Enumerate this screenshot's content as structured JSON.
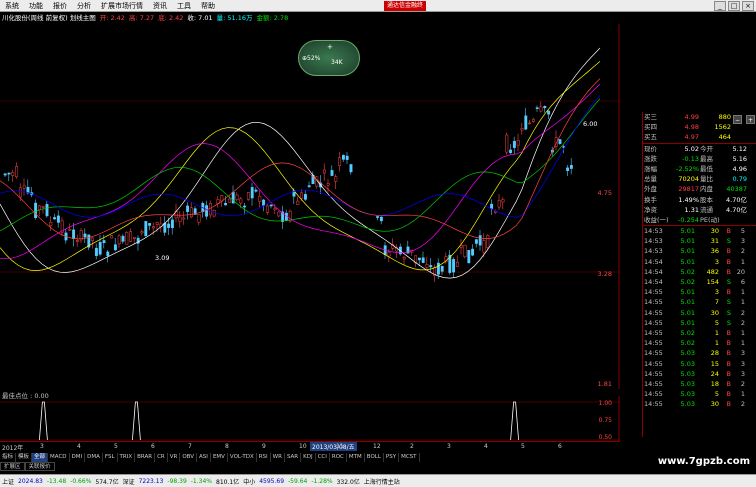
{
  "menu": {
    "items": [
      "系统",
      "功能",
      "报价",
      "分析",
      "扩展市场行情",
      "资讯",
      "工具",
      "帮助"
    ],
    "promo": "通达信金融终"
  },
  "window": {
    "min": "_",
    "max": "□",
    "close": "×"
  },
  "chartinfo": {
    "title": "川化股份(周线 前复权) 划线主图",
    "open_label": "开: 2.42",
    "high_label": "高: 7.27",
    "low_label": "底: 2.42",
    "close_label": "收: 7.01",
    "volume_label": "量: 51.16万",
    "amount_label": "金额: 2.78"
  },
  "widget": {
    "label1": "⊕52%",
    "label2": "34K",
    "label3": "+"
  },
  "main_chart": {
    "price_labels": [
      "4.75",
      "3.28",
      "1.81"
    ],
    "peak_label": "6.00",
    "low_label": "3.09"
  },
  "indicator": {
    "title": "最佳点位 : 0.00",
    "labels": [
      "1.00",
      "0.75",
      "0.50"
    ],
    "spikes": [
      0.07,
      0.22,
      0.83
    ]
  },
  "timebar": {
    "year_label": "2012年",
    "date_label": "2013/03/08/五",
    "marks": [
      "3",
      "4",
      "5",
      "6",
      "7",
      "8",
      "9",
      "10",
      "11",
      "12",
      "2",
      "3",
      "4",
      "5",
      "6"
    ]
  },
  "tabs": [
    "指标",
    "模板",
    "全部",
    "MACD",
    "DMI",
    "DMA",
    "FSL",
    "TRIX",
    "BRAR",
    "CR",
    "VR",
    "OBV",
    "ASI",
    "EMV",
    "VOL-TDX",
    "RSI",
    "WR",
    "SAR",
    "KDJ",
    "CCI",
    "ROC",
    "MTM",
    "BOLL",
    "PSY",
    "MCST"
  ],
  "subtabs": [
    "扩展区",
    "关联报价"
  ],
  "status": {
    "sh_label": "上证",
    "sh_value": "2024.83",
    "sh_change": "-13.48",
    "sh_pct": "-0.66%",
    "sh_amount": "574.7亿",
    "sz_label": "深证",
    "sz_value": "7223.13",
    "sz_change": "-98.39",
    "sz_pct": "-1.34%",
    "sz_amount": "810.1亿",
    "zx_label": "中小",
    "zx_value": "4595.69",
    "zx_change": "-59.64",
    "zx_pct": "-1.28%",
    "zx_amount": "332.0亿",
    "station": "上海行情主站"
  },
  "watermark": "www.7gpzb.com",
  "quote": {
    "asks": [
      {
        "label": "买三",
        "price": "4.99",
        "vol": "880"
      },
      {
        "label": "买四",
        "price": "4.98",
        "vol": "1562"
      },
      {
        "label": "买五",
        "price": "4.97",
        "vol": "464"
      }
    ],
    "stats": [
      {
        "l1": "现价",
        "v1": "5.02",
        "l2": "今开",
        "v2": "5.12"
      },
      {
        "l1": "涨跌",
        "v1": "-0.13",
        "l2": "最高",
        "v2": "5.16"
      },
      {
        "l1": "涨幅",
        "v1": "-2.52%",
        "l2": "最低",
        "v2": "4.96"
      },
      {
        "l1": "总量",
        "v1": "70204",
        "l2": "量比",
        "v2": "0.79"
      },
      {
        "l1": "外盘",
        "v1": "29817",
        "l2": "内盘",
        "v2": "40387"
      },
      {
        "l1": "换手",
        "v1": "1.49%",
        "l2": "股本",
        "v2": "4.70亿"
      },
      {
        "l1": "净资",
        "v1": "1.31",
        "l2": "流通",
        "v2": "4.70亿"
      },
      {
        "l1": "收益(一)",
        "v1": "-0.254",
        "l2": "PE(动)",
        "v2": ""
      }
    ],
    "ticks": [
      {
        "t": "14:53",
        "p": "5.01",
        "v": "30",
        "s": "B",
        "n": "5"
      },
      {
        "t": "14:53",
        "p": "5.01",
        "v": "31",
        "s": "S",
        "n": "3"
      },
      {
        "t": "14:53",
        "p": "5.01",
        "v": "36",
        "s": "B",
        "n": "2"
      },
      {
        "t": "14:54",
        "p": "5.01",
        "v": "3",
        "s": "B",
        "n": "1"
      },
      {
        "t": "14:54",
        "p": "5.02",
        "v": "482",
        "s": "B",
        "n": "20"
      },
      {
        "t": "14:54",
        "p": "5.02",
        "v": "154",
        "s": "S",
        "n": "6"
      },
      {
        "t": "14:55",
        "p": "5.01",
        "v": "3",
        "s": "B",
        "n": "1"
      },
      {
        "t": "14:55",
        "p": "5.01",
        "v": "7",
        "s": "S",
        "n": "1"
      },
      {
        "t": "14:55",
        "p": "5.01",
        "v": "30",
        "s": "S",
        "n": "2"
      },
      {
        "t": "14:55",
        "p": "5.01",
        "v": "5",
        "s": "S",
        "n": "2"
      },
      {
        "t": "14:55",
        "p": "5.02",
        "v": "1",
        "s": "B",
        "n": "1"
      },
      {
        "t": "14:55",
        "p": "5.02",
        "v": "1",
        "s": "B",
        "n": "1"
      },
      {
        "t": "14:55",
        "p": "5.03",
        "v": "28",
        "s": "B",
        "n": "3"
      },
      {
        "t": "14:55",
        "p": "5.03",
        "v": "15",
        "s": "B",
        "n": "3"
      },
      {
        "t": "14:55",
        "p": "5.03",
        "v": "24",
        "s": "B",
        "n": "3"
      },
      {
        "t": "14:55",
        "p": "5.03",
        "v": "18",
        "s": "B",
        "n": "2"
      },
      {
        "t": "14:55",
        "p": "5.03",
        "v": "5",
        "s": "B",
        "n": "1"
      },
      {
        "t": "14:55",
        "p": "5.03",
        "v": "30",
        "s": "B",
        "n": "2"
      }
    ]
  }
}
